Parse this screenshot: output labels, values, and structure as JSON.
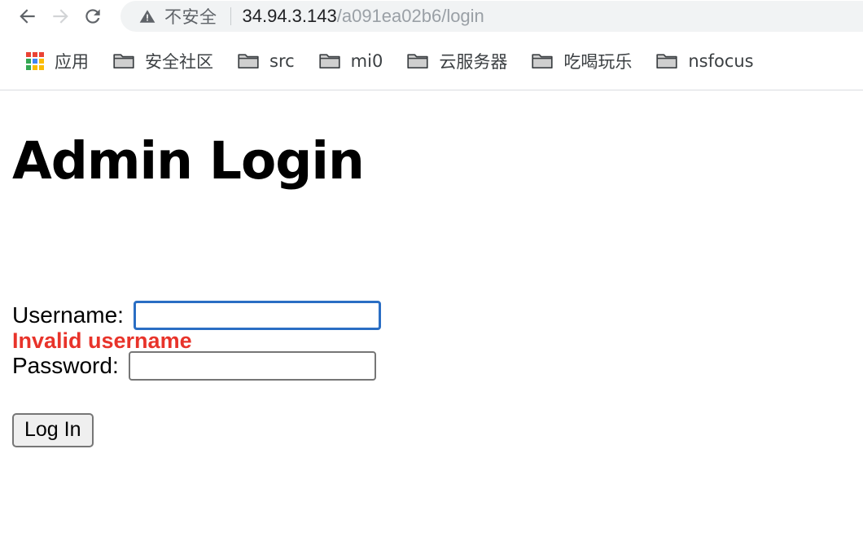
{
  "browser": {
    "nav": {
      "back_icon": "arrow-left-icon",
      "forward_icon": "arrow-right-icon",
      "reload_icon": "reload-icon"
    },
    "omnibox": {
      "security_icon": "warning-triangle-icon",
      "security_label": "不安全",
      "url_host": "34.94.3.143",
      "url_path": "/a091ea02b6/login",
      "full_url": "34.94.3.143/a091ea02b6/login"
    },
    "bookmarks": [
      {
        "label": "应用",
        "icon": "apps-grid-icon"
      },
      {
        "label": "安全社区",
        "icon": "folder-icon"
      },
      {
        "label": "src",
        "icon": "folder-icon"
      },
      {
        "label": "mi0",
        "icon": "folder-icon"
      },
      {
        "label": "云服务器",
        "icon": "folder-icon"
      },
      {
        "label": "吃喝玩乐",
        "icon": "folder-icon"
      },
      {
        "label": "nsfocus",
        "icon": "folder-icon"
      }
    ]
  },
  "page": {
    "title": "Admin Login",
    "error_message": "Invalid username",
    "form": {
      "username_label": "Username:",
      "username_value": "",
      "password_label": "Password:",
      "password_value": "",
      "submit_label": "Log In"
    }
  },
  "colors": {
    "error_red": "#e8332a",
    "focus_blue": "#2a6ec4",
    "omnibox_bg": "#f1f3f4",
    "button_bg": "#efefef",
    "border_gray": "#767676"
  }
}
